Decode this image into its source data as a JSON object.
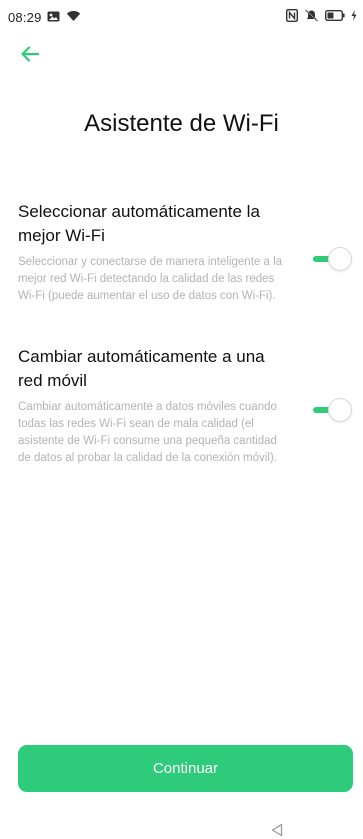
{
  "status_bar": {
    "time": "08:29",
    "icons": [
      "image-notification-icon",
      "wifi-icon",
      "nfc-icon",
      "mute-icon",
      "battery-icon",
      "charging-icon"
    ]
  },
  "header": {
    "back_icon": "arrow-left-icon",
    "title": "Asistente de Wi-Fi"
  },
  "settings": [
    {
      "title": "Seleccionar automáticamente la mejor Wi-Fi",
      "description": "Seleccionar y conectarse de manera inteligente a la mejor red Wi-Fi detectando la calidad de las redes Wi-Fi (puede aumentar el uso de datos con Wi-Fi).",
      "enabled": true
    },
    {
      "title": "Cambiar automáticamente a una red móvil",
      "description": "Cambiar automáticamente a datos móviles cuando todas las redes Wi-Fi sean de mala calidad (el asistente de Wi-Fi consume una pequeña cantidad de datos al probar la calidad de la conexión móvil).",
      "enabled": true
    }
  ],
  "footer": {
    "continue_label": "Continuar"
  },
  "nav_bar": {
    "back_icon": "triangle-back-icon"
  },
  "colors": {
    "accent": "#2ecc7a",
    "secondary_text": "#b3b3b3"
  }
}
